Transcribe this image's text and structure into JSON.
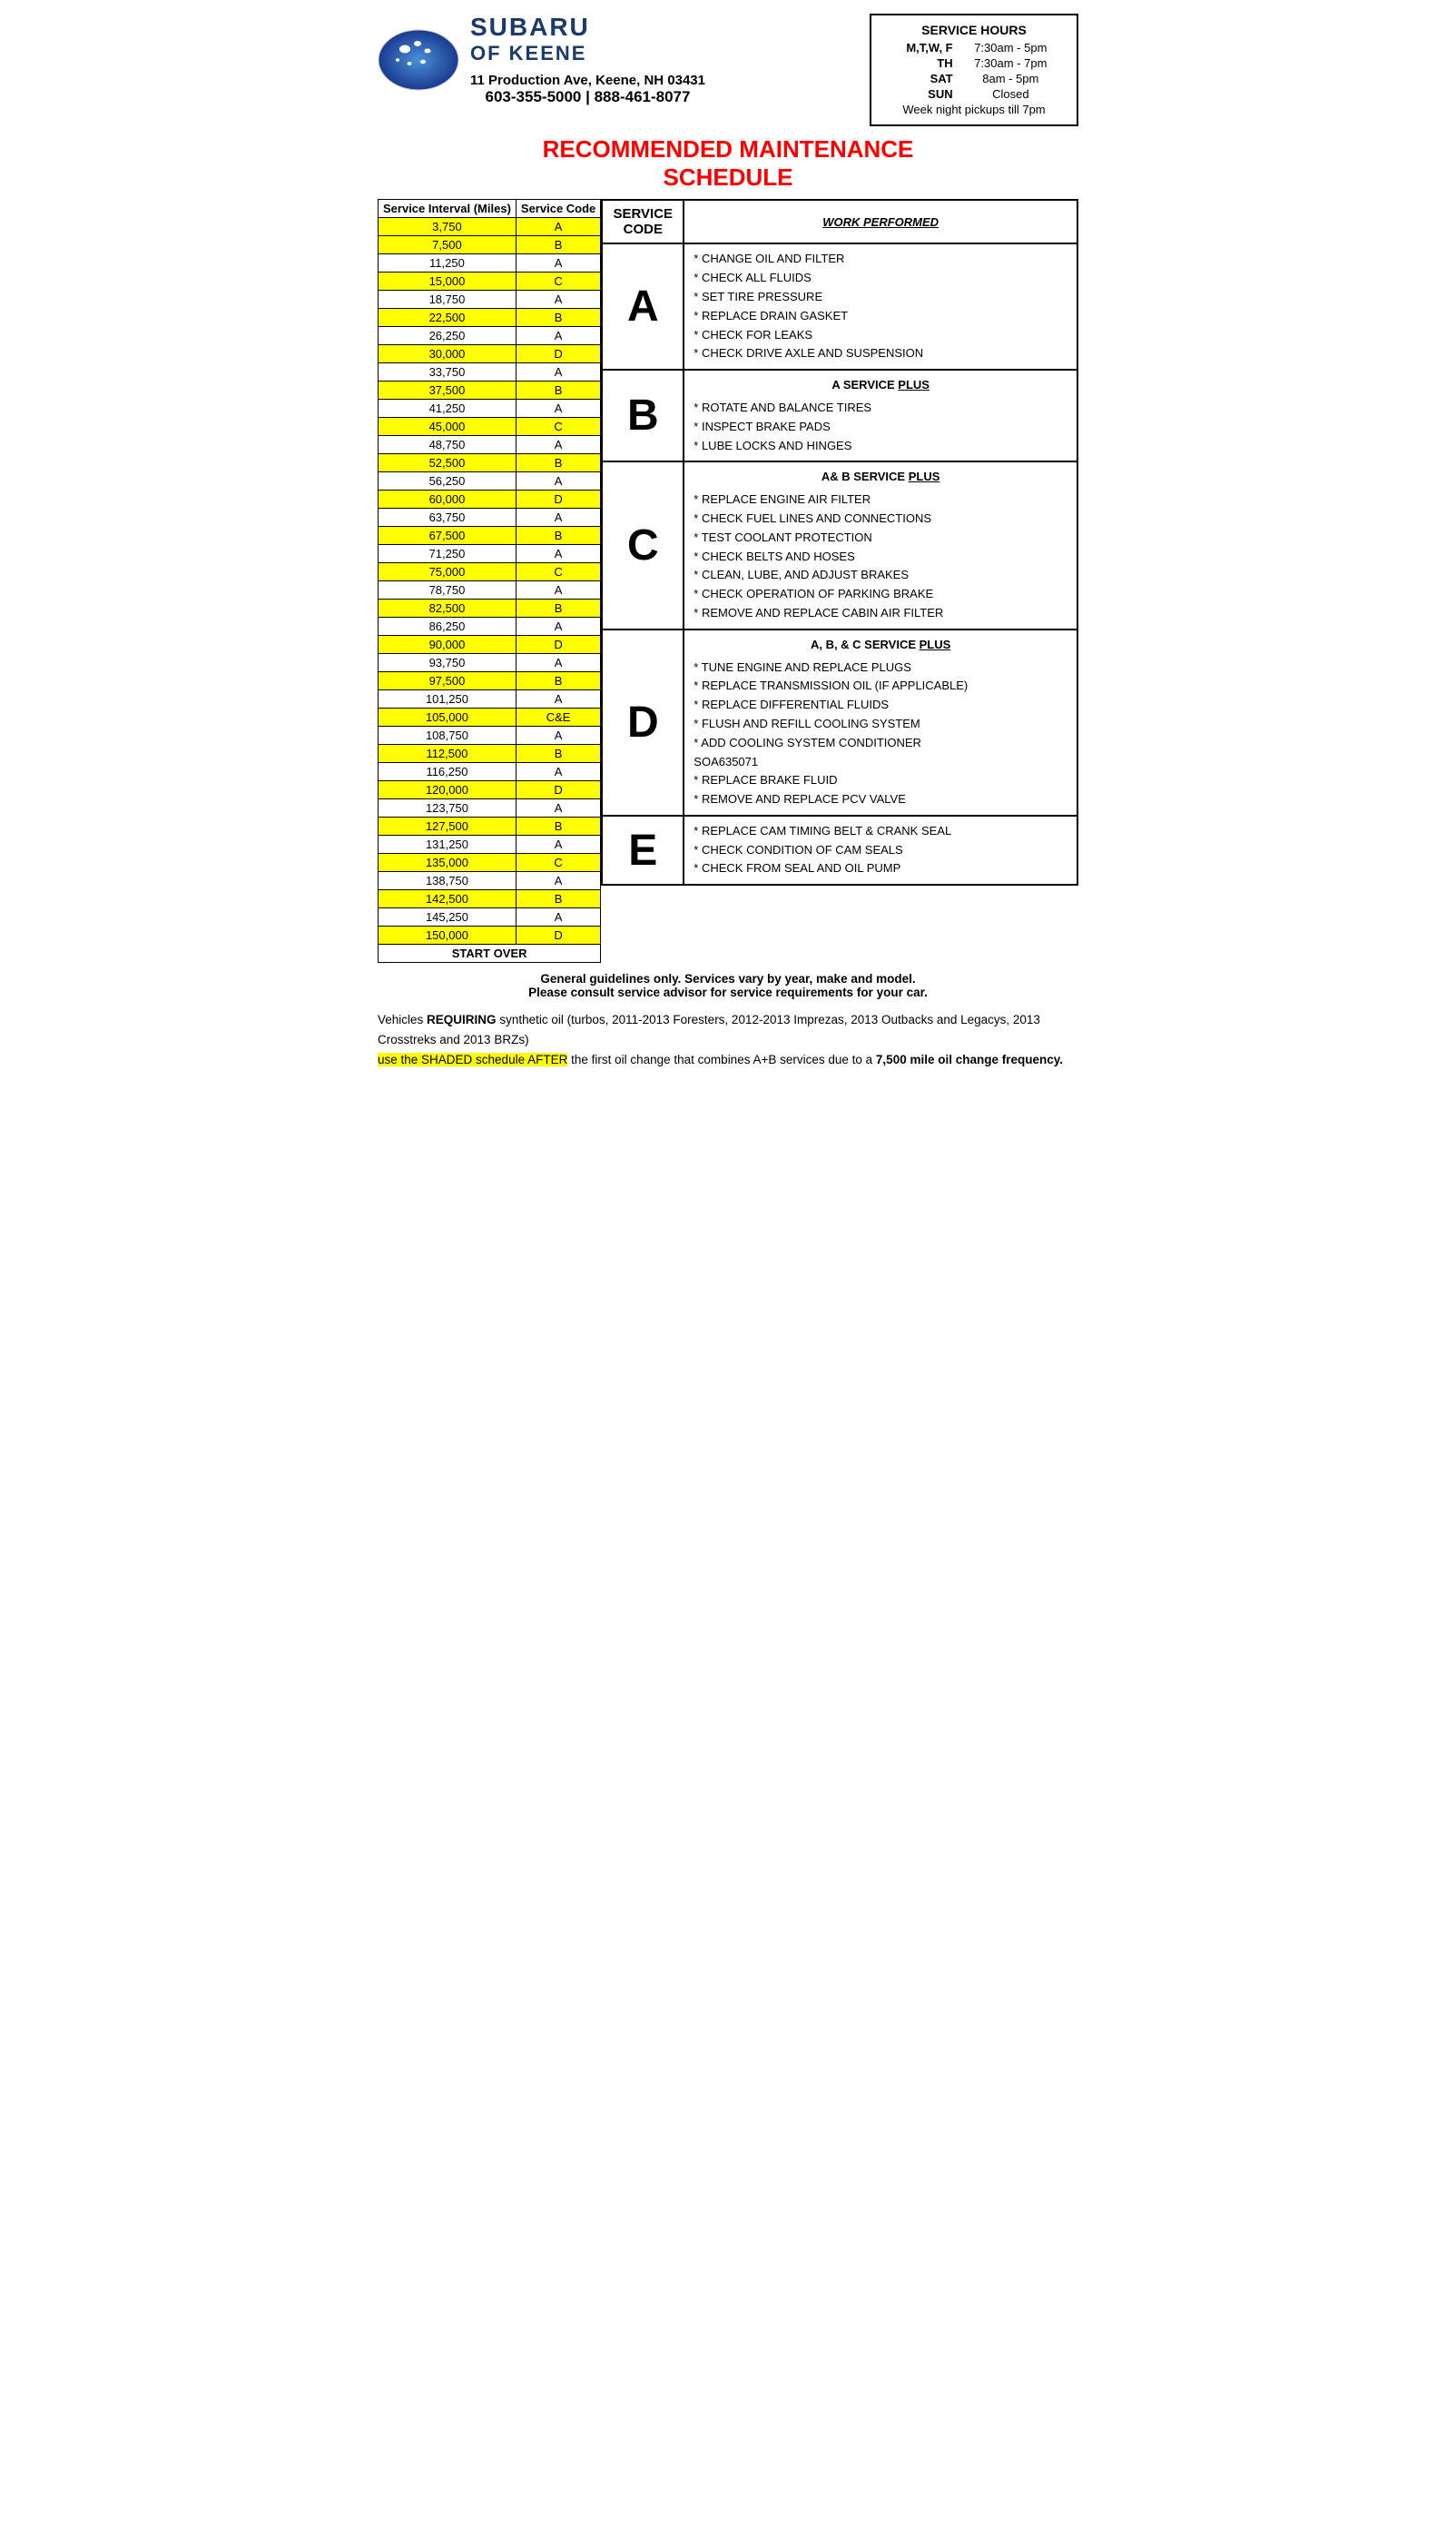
{
  "header": {
    "brand": "SUBARU",
    "brand_sub": "OF KEENE",
    "address": "11 Production Ave, Keene, NH  03431",
    "phone": "603-355-5000 | 888-461-8077",
    "service_hours_title": "SERVICE HOURS",
    "hours": [
      {
        "days": "M,T,W, F",
        "time": "7:30am - 5pm"
      },
      {
        "days": "TH",
        "time": "7:30am - 7pm"
      },
      {
        "days": "SAT",
        "time": "8am - 5pm"
      },
      {
        "days": "SUN",
        "time": "Closed"
      },
      {
        "days": "Week night pickups till 7pm",
        "time": ""
      }
    ]
  },
  "main_title_line1": "RECOMMENDED MAINTENANCE",
  "main_title_line2": "SCHEDULE",
  "schedule_header": {
    "col1": "Service Interval (Miles)",
    "col2": "Service Code"
  },
  "schedule_rows": [
    {
      "miles": "3,750",
      "code": "A",
      "yellow": true
    },
    {
      "miles": "7,500",
      "code": "B",
      "yellow": true
    },
    {
      "miles": "11,250",
      "code": "A",
      "yellow": false
    },
    {
      "miles": "15,000",
      "code": "C",
      "yellow": true
    },
    {
      "miles": "18,750",
      "code": "A",
      "yellow": false
    },
    {
      "miles": "22,500",
      "code": "B",
      "yellow": true
    },
    {
      "miles": "26,250",
      "code": "A",
      "yellow": false
    },
    {
      "miles": "30,000",
      "code": "D",
      "yellow": true
    },
    {
      "miles": "33,750",
      "code": "A",
      "yellow": false
    },
    {
      "miles": "37,500",
      "code": "B",
      "yellow": true
    },
    {
      "miles": "41,250",
      "code": "A",
      "yellow": false
    },
    {
      "miles": "45,000",
      "code": "C",
      "yellow": true
    },
    {
      "miles": "48,750",
      "code": "A",
      "yellow": false
    },
    {
      "miles": "52,500",
      "code": "B",
      "yellow": true
    },
    {
      "miles": "56,250",
      "code": "A",
      "yellow": false
    },
    {
      "miles": "60,000",
      "code": "D",
      "yellow": true
    },
    {
      "miles": "63,750",
      "code": "A",
      "yellow": false
    },
    {
      "miles": "67,500",
      "code": "B",
      "yellow": true
    },
    {
      "miles": "71,250",
      "code": "A",
      "yellow": false
    },
    {
      "miles": "75,000",
      "code": "C",
      "yellow": true
    },
    {
      "miles": "78,750",
      "code": "A",
      "yellow": false
    },
    {
      "miles": "82,500",
      "code": "B",
      "yellow": true
    },
    {
      "miles": "86,250",
      "code": "A",
      "yellow": false
    },
    {
      "miles": "90,000",
      "code": "D",
      "yellow": true
    },
    {
      "miles": "93,750",
      "code": "A",
      "yellow": false
    },
    {
      "miles": "97,500",
      "code": "B",
      "yellow": true
    },
    {
      "miles": "101,250",
      "code": "A",
      "yellow": false
    },
    {
      "miles": "105,000",
      "code": "C&E",
      "yellow": true
    },
    {
      "miles": "108,750",
      "code": "A",
      "yellow": false
    },
    {
      "miles": "112,500",
      "code": "B",
      "yellow": true
    },
    {
      "miles": "116,250",
      "code": "A",
      "yellow": false
    },
    {
      "miles": "120,000",
      "code": "D",
      "yellow": true
    },
    {
      "miles": "123,750",
      "code": "A",
      "yellow": false
    },
    {
      "miles": "127,500",
      "code": "B",
      "yellow": true
    },
    {
      "miles": "131,250",
      "code": "A",
      "yellow": false
    },
    {
      "miles": "135,000",
      "code": "C",
      "yellow": true
    },
    {
      "miles": "138,750",
      "code": "A",
      "yellow": false
    },
    {
      "miles": "142,500",
      "code": "B",
      "yellow": true
    },
    {
      "miles": "145,250",
      "code": "A",
      "yellow": false
    },
    {
      "miles": "150,000",
      "code": "D",
      "yellow": true
    }
  ],
  "start_over": "START OVER",
  "services_col_header": "SERVICE CODE",
  "work_performed_header": "WORK PERFORMED",
  "services": [
    {
      "letter": "A",
      "heading": "",
      "items": [
        "* CHANGE OIL AND FILTER",
        "* CHECK ALL FLUIDS",
        "* SET TIRE PRESSURE",
        "* REPLACE DRAIN GASKET",
        "* CHECK FOR LEAKS",
        "* CHECK DRIVE AXLE AND SUSPENSION"
      ]
    },
    {
      "letter": "B",
      "heading": "A SERVICE PLUS",
      "items": [
        "* ROTATE AND BALANCE TIRES",
        "* INSPECT BRAKE PADS",
        "* LUBE LOCKS AND HINGES"
      ]
    },
    {
      "letter": "C",
      "heading": "A& B SERVICE PLUS",
      "items": [
        "* REPLACE ENGINE AIR FILTER",
        "* CHECK FUEL LINES AND CONNECTIONS",
        "* TEST COOLANT PROTECTION",
        "* CHECK BELTS AND HOSES",
        "* CLEAN, LUBE, AND ADJUST BRAKES",
        "* CHECK OPERATION OF PARKING BRAKE",
        "* REMOVE AND REPLACE CABIN AIR FILTER"
      ]
    },
    {
      "letter": "D",
      "heading": "A, B, & C SERVICE PLUS",
      "items": [
        "* TUNE ENGINE AND REPLACE PLUGS",
        "* REPLACE TRANSMISSION OIL (IF APPLICABLE)",
        "* REPLACE DIFFERENTIAL FLUIDS",
        "* FLUSH AND REFILL COOLING SYSTEM",
        "* ADD COOLING SYSTEM CONDITIONER",
        "   SOA635071",
        "* REPLACE BRAKE FLUID",
        "* REMOVE AND REPLACE PCV VALVE"
      ]
    },
    {
      "letter": "E",
      "heading": "",
      "items": [
        "* REPLACE CAM TIMING BELT & CRANK SEAL",
        "* CHECK CONDITION OF CAM SEALS",
        "* CHECK FROM SEAL AND OIL PUMP"
      ]
    }
  ],
  "footer": {
    "note1": "General guidelines only. Services vary by year, make and model.",
    "note2": "Please consult service advisor for service requirements for your car.",
    "para1_pre": "Vehicles ",
    "para1_bold1": "REQUIRING",
    "para1_mid": " synthetic oil (turbos, 2011-2013 Foresters, 2012-2013 Imprezas, 2013 Outbacks and Legacys, 2013 Crosstreks and 2013 BRZs)",
    "para1_highlight": "use the SHADED schedule AFTER",
    "para1_after": " the first oil change that combines A+B services due to a ",
    "para1_bold2": "7,500 mile oil change frequency."
  }
}
